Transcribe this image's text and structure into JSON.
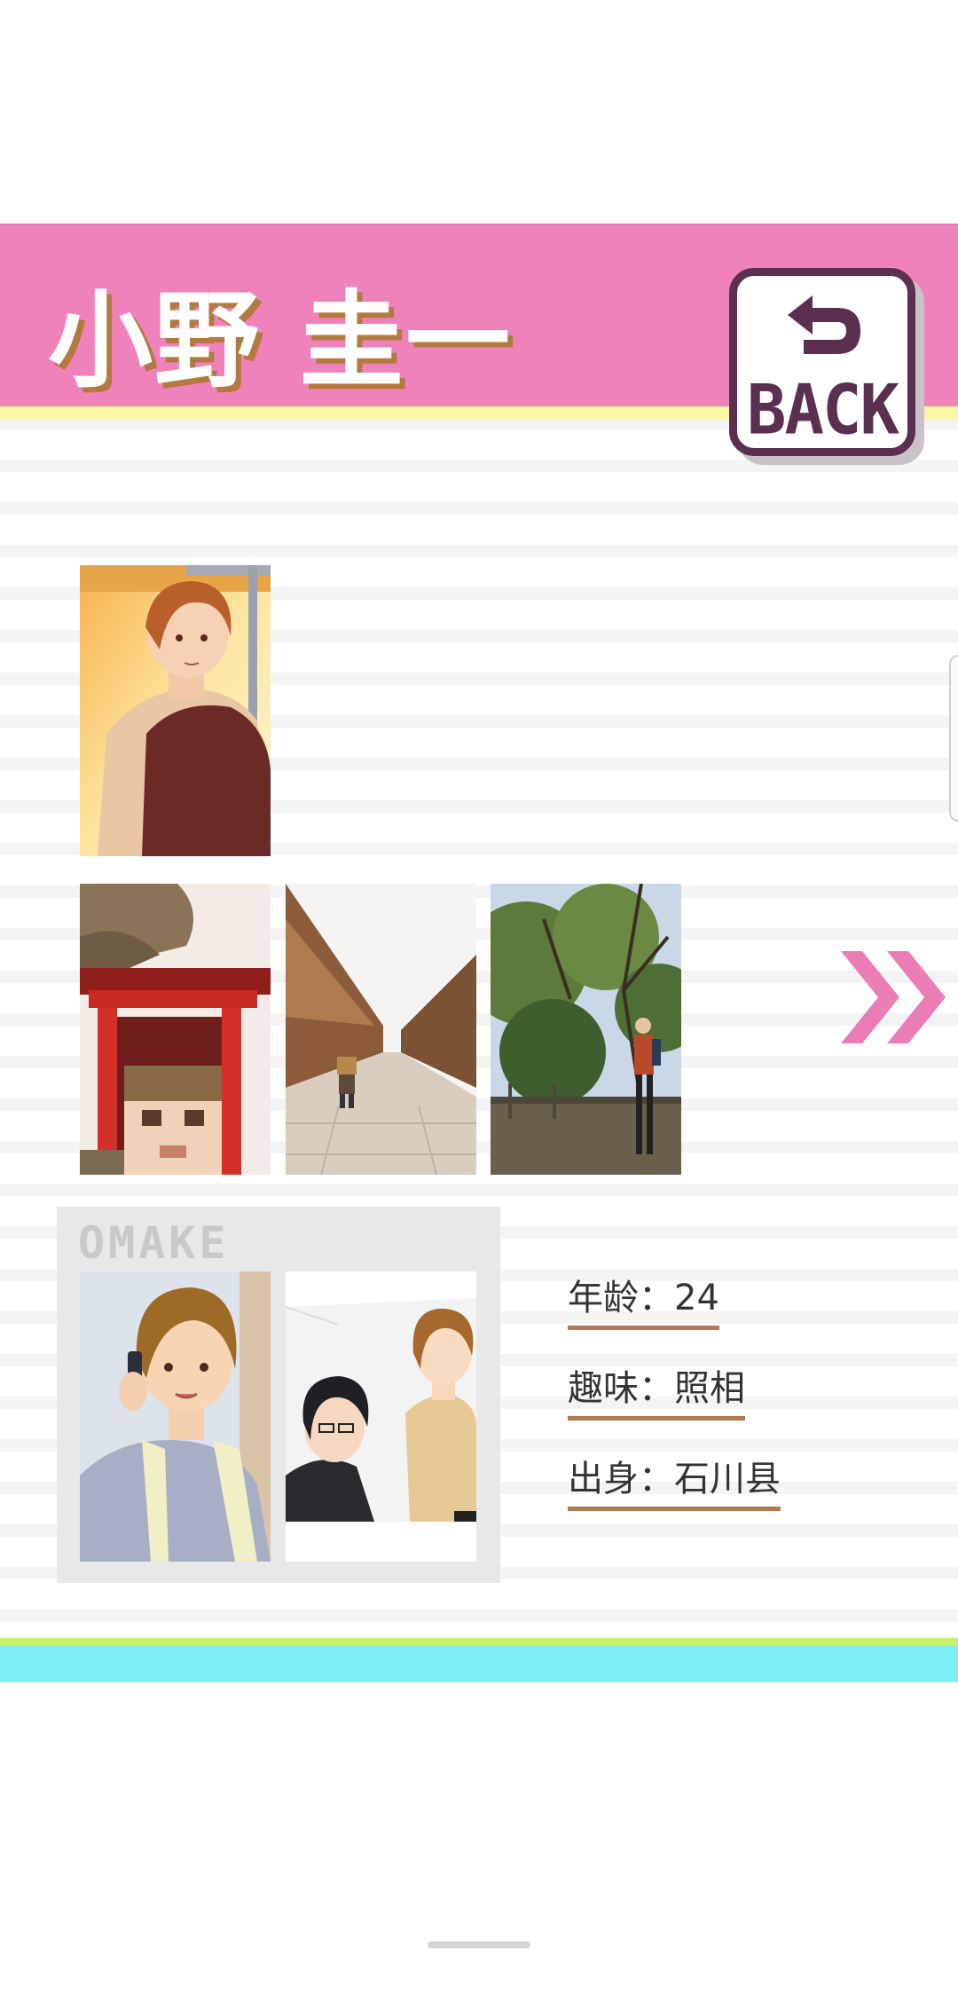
{
  "header": {
    "title": "小野 圭一",
    "back_label": "BACK",
    "colors": {
      "band": "#ef82bb",
      "accent_line": "#fbf7a6",
      "title_shadow": "#b27a3f",
      "button": "#5a2f4f"
    }
  },
  "gallery": {
    "portrait": "character-portrait",
    "photos": [
      "shrine-photo",
      "old-street-photo",
      "park-photo"
    ],
    "next_icon": "double-chevron-right-icon"
  },
  "omake": {
    "title": "OMAKE",
    "images": [
      "phone-call-illustration",
      "two-characters-illustration"
    ]
  },
  "profile": {
    "age": "年龄：24",
    "hobby": "趣味：照相",
    "origin": "出身：石川县"
  },
  "footer": {
    "colors": {
      "green": "#c9ef6b",
      "cyan": "#7eeff4"
    }
  }
}
